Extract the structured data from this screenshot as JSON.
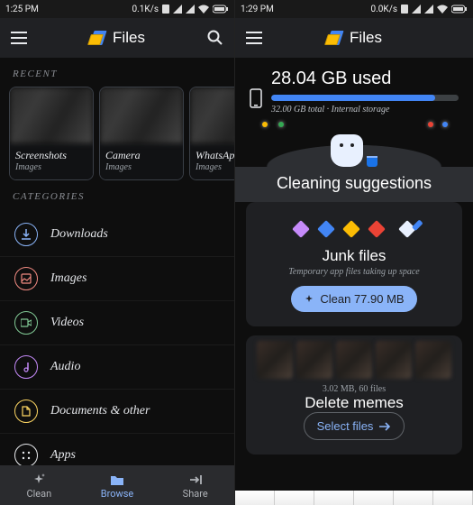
{
  "left": {
    "status": {
      "time": "1:25 PM",
      "net": "0.1K/s"
    },
    "app_title": "Files",
    "section_recent": "RECENT",
    "recent": [
      {
        "name": "Screenshots",
        "type": "Images"
      },
      {
        "name": "Camera",
        "type": "Images"
      },
      {
        "name": "WhatsAp",
        "type": "Images"
      }
    ],
    "section_categories": "CATEGORIES",
    "categories": [
      {
        "label": "Downloads",
        "icon": "download-icon",
        "color": "#8ab4f8"
      },
      {
        "label": "Images",
        "icon": "image-icon",
        "color": "#f28b82"
      },
      {
        "label": "Videos",
        "icon": "video-icon",
        "color": "#81c995"
      },
      {
        "label": "Audio",
        "icon": "audio-icon",
        "color": "#c58af9"
      },
      {
        "label": "Documents & other",
        "icon": "document-icon",
        "color": "#fdd663"
      },
      {
        "label": "Apps",
        "icon": "apps-icon",
        "color": "#e8eaed"
      }
    ],
    "nav": {
      "clean": "Clean",
      "browse": "Browse",
      "share": "Share"
    }
  },
  "right": {
    "status": {
      "time": "1:29 PM",
      "net": "0.0K/s"
    },
    "app_title": "Files",
    "storage": {
      "used": "28.04 GB used",
      "sub": "32.00 GB total · Internal storage",
      "percent": 87.6
    },
    "suggestions_title": "Cleaning suggestions",
    "junk": {
      "title": "Junk files",
      "sub": "Temporary app files taking up space",
      "button": "Clean 77.90 MB"
    },
    "memes": {
      "meta": "3.02 MB, 60 files",
      "title": "Delete memes",
      "button": "Select files"
    }
  }
}
